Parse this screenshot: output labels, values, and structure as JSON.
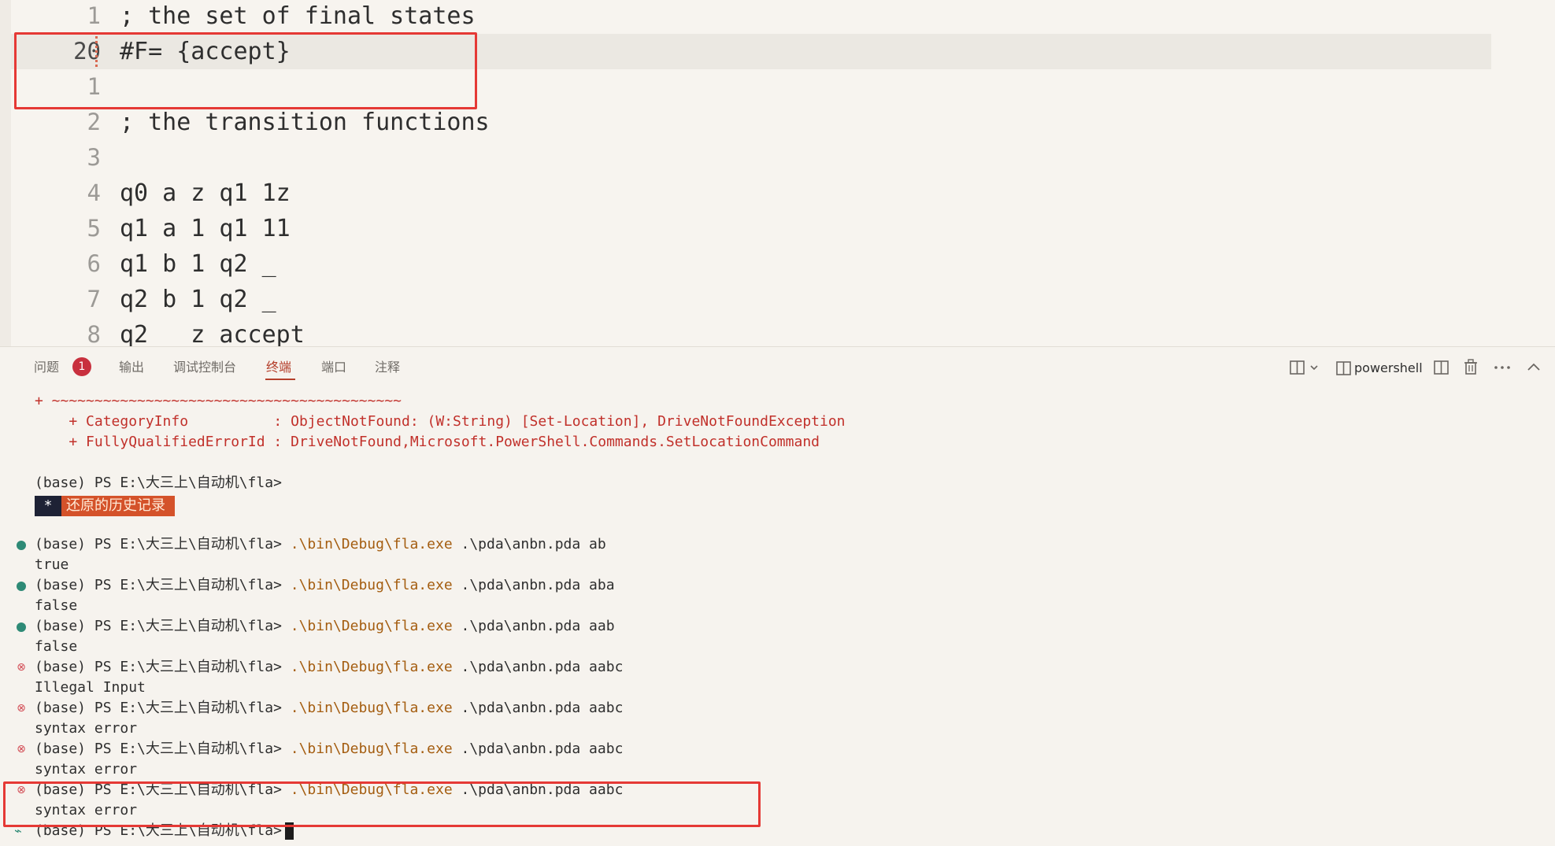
{
  "editor": {
    "lines": [
      {
        "number": "1",
        "text": "; the set of final states",
        "current": false
      },
      {
        "number": "20",
        "text": "#F= {accept}",
        "current": true
      },
      {
        "number": "1",
        "text": "",
        "current": false
      },
      {
        "number": "2",
        "text": "; the transition functions",
        "current": false
      },
      {
        "number": "3",
        "text": "",
        "current": false
      },
      {
        "number": "4",
        "text": "q0 a z q1 1z",
        "current": false
      },
      {
        "number": "5",
        "text": "q1 a 1 q1 11",
        "current": false
      },
      {
        "number": "6",
        "text": "q1 b 1 q2 _",
        "current": false
      },
      {
        "number": "7",
        "text": "q2 b 1 q2 _",
        "current": false
      },
      {
        "number": "8",
        "text": "q2   z accept",
        "current": false
      }
    ]
  },
  "panel": {
    "tabs": {
      "problems": "问题",
      "problems_count": "1",
      "output": "输出",
      "debug_console": "调试控制台",
      "terminal": "终端",
      "ports": "端口",
      "comments": "注释"
    },
    "terminal_name": "powershell"
  },
  "terminal": {
    "error_tilde": "+ ~~~~~~~~~~~~~~~~~~~~~~~~~~~~~~~~~~~~~~~~~",
    "error_category": "    + CategoryInfo          : ObjectNotFound: (W:String) [Set-Location], DriveNotFoundException",
    "error_fqid": "    + FullyQualifiedErrorId : DriveNotFound,Microsoft.PowerShell.Commands.SetLocationCommand",
    "prompt": "(base) PS E:\\大三上\\自动机\\fla>",
    "restore_star": "*",
    "restore_text": "还原的历史记录",
    "command": ".\\bin\\Debug\\fla.exe",
    "runs": [
      {
        "args": ".\\pda\\anbn.pda ab",
        "output": "true",
        "status": "ok"
      },
      {
        "args": ".\\pda\\anbn.pda aba",
        "output": "false",
        "status": "ok"
      },
      {
        "args": ".\\pda\\anbn.pda aab",
        "output": "false",
        "status": "ok"
      },
      {
        "args": ".\\pda\\anbn.pda aabc",
        "output": "Illegal Input",
        "status": "error"
      },
      {
        "args": ".\\pda\\anbn.pda aabc",
        "output": "syntax error",
        "status": "error"
      },
      {
        "args": ".\\pda\\anbn.pda aabc",
        "output": "syntax error",
        "status": "error"
      },
      {
        "args": ".\\pda\\anbn.pda aabc",
        "output": "syntax error",
        "status": "error"
      }
    ]
  },
  "colors": {
    "accent": "#b43f2b",
    "success_decoration": "#2e8a76",
    "error_decoration": "#d24b54",
    "highlight_box": "#e53935",
    "command_text": "#a45d10"
  },
  "icons": {
    "split_layout": "split-layout-icon",
    "terminal_profile": "terminal-icon",
    "split_terminal": "split-terminal-icon",
    "kill_terminal": "trash-icon",
    "more": "more-icon",
    "maximize": "chevron-up-icon"
  }
}
